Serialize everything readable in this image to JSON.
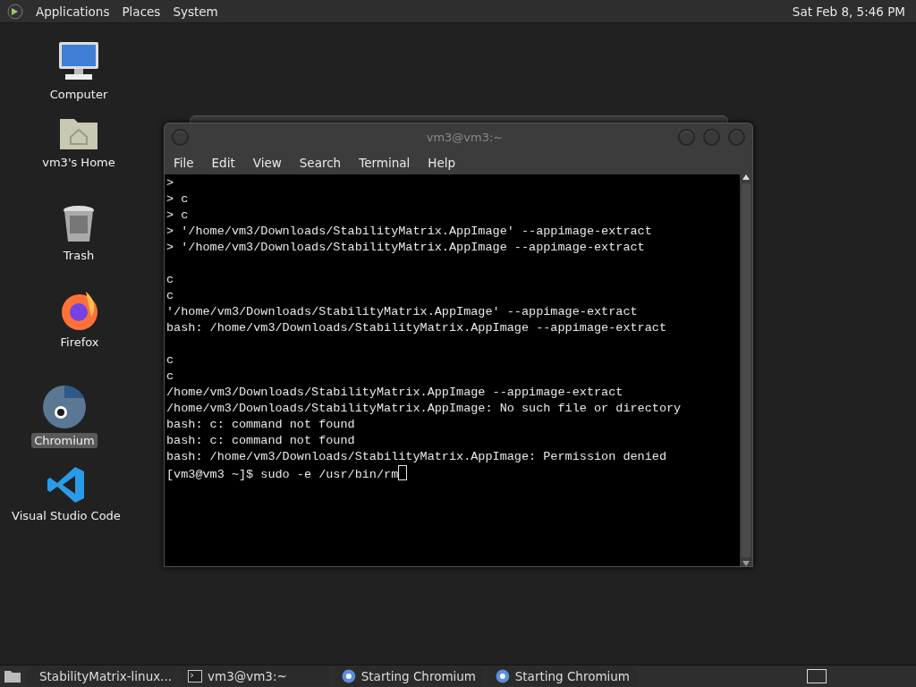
{
  "top_panel": {
    "menus": [
      "Applications",
      "Places",
      "System"
    ],
    "clock": "Sat Feb 8,  5:46 PM"
  },
  "desktop_icons": [
    {
      "kind": "computer",
      "label": "Computer",
      "selected": false
    },
    {
      "kind": "home",
      "label": "vm3's Home",
      "selected": false
    },
    {
      "kind": "trash",
      "label": "Trash",
      "selected": false
    },
    {
      "kind": "firefox",
      "label": "Firefox",
      "selected": false
    },
    {
      "kind": "chromium",
      "label": "Chromium",
      "selected": true
    },
    {
      "kind": "vscode",
      "label": "Visual Studio Code",
      "selected": false
    }
  ],
  "terminal": {
    "title": "vm3@vm3:~",
    "menu": [
      "File",
      "Edit",
      "View",
      "Search",
      "Terminal",
      "Help"
    ],
    "lines": [
      {
        "kind": "text",
        "text": ">"
      },
      {
        "kind": "text",
        "text": "> c"
      },
      {
        "kind": "text",
        "text": "> c"
      },
      {
        "kind": "text",
        "text": "> '/home/vm3/Downloads/StabilityMatrix.AppImage' --appimage-extract"
      },
      {
        "kind": "text",
        "text": "> '/home/vm3/Downloads/StabilityMatrix.AppImage --appimage-extract"
      },
      {
        "kind": "blank"
      },
      {
        "kind": "text",
        "text": "c"
      },
      {
        "kind": "text",
        "text": "c"
      },
      {
        "kind": "text",
        "text": "'/home/vm3/Downloads/StabilityMatrix.AppImage' --appimage-extract"
      },
      {
        "kind": "text",
        "text": "bash: /home/vm3/Downloads/StabilityMatrix.AppImage --appimage-extract"
      },
      {
        "kind": "blank"
      },
      {
        "kind": "text",
        "text": "c"
      },
      {
        "kind": "text",
        "text": "c"
      },
      {
        "kind": "text",
        "text": "/home/vm3/Downloads/StabilityMatrix.AppImage --appimage-extract"
      },
      {
        "kind": "text",
        "text": "/home/vm3/Downloads/StabilityMatrix.AppImage: No such file or directory"
      },
      {
        "kind": "text",
        "text": "bash: c: command not found"
      },
      {
        "kind": "text",
        "text": "bash: c: command not found"
      },
      {
        "kind": "text",
        "text": "bash: /home/vm3/Downloads/StabilityMatrix.AppImage: Permission denied"
      },
      {
        "kind": "prompt",
        "text": "[vm3@vm3 ~]$ sudo -e /usr/bin/rm"
      }
    ]
  },
  "taskbar": {
    "tasks": [
      {
        "kind": "installer",
        "label": "StabilityMatrix-linux..."
      },
      {
        "kind": "terminal",
        "label": "vm3@vm3:~"
      },
      {
        "kind": "chromium",
        "label": "Starting Chromium"
      },
      {
        "kind": "chromium",
        "label": "Starting Chromium"
      }
    ]
  }
}
